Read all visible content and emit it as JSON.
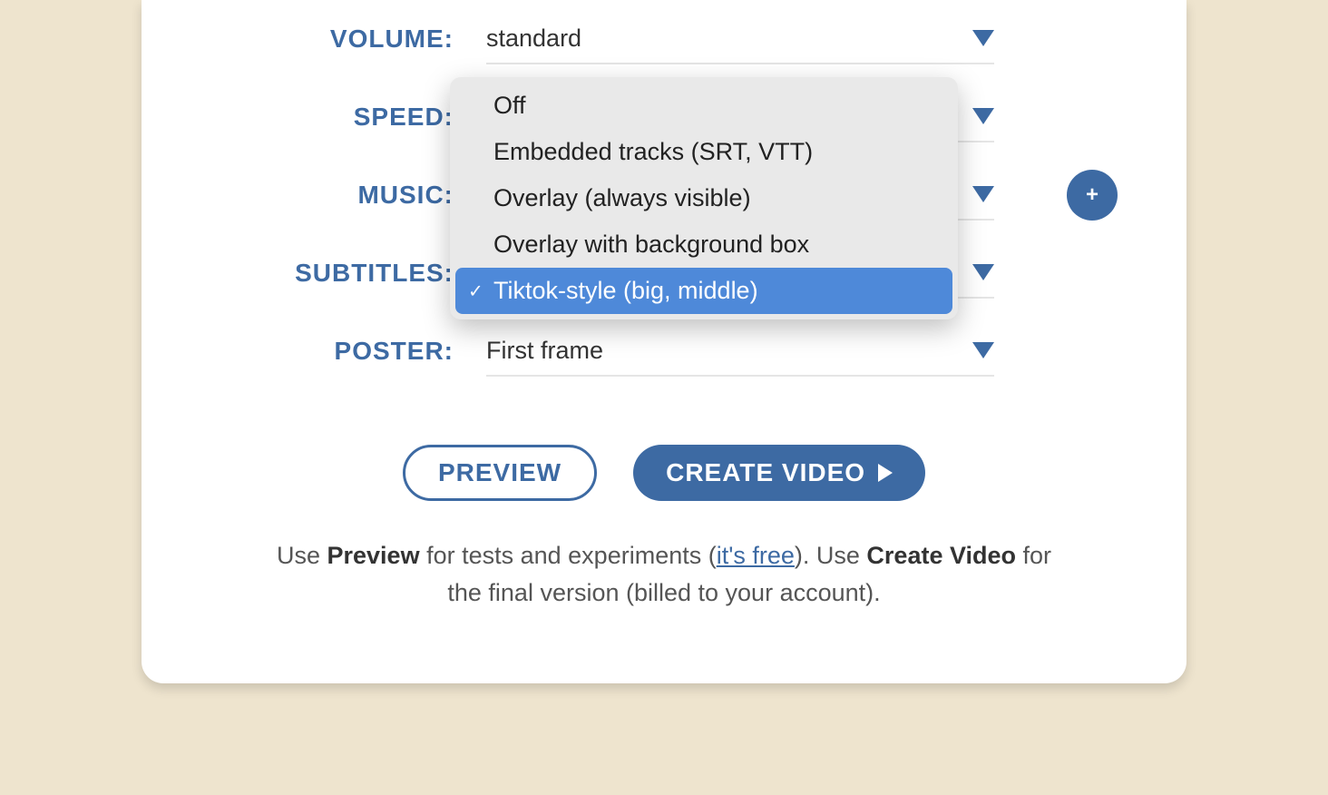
{
  "volume": {
    "label": "VOLUME:",
    "value": "standard"
  },
  "speed": {
    "label": "SPEED:"
  },
  "music": {
    "label": "MUSIC:"
  },
  "subtitles": {
    "label": "SUBTITLES:",
    "options": [
      "Off",
      "Embedded tracks (SRT, VTT)",
      "Overlay (always visible)",
      "Overlay with background box",
      "Tiktok-style (big, middle)"
    ],
    "selectedIndex": 4
  },
  "poster": {
    "label": "POSTER:",
    "value": "First frame"
  },
  "buttons": {
    "preview": "PREVIEW",
    "create": "CREATE VIDEO"
  },
  "hint": {
    "use1": "Use ",
    "previewWord": "Preview",
    "middle1": " for tests and experiments (",
    "freeLink": "it's free",
    "middle2": "). Use ",
    "createWord": "Create Video",
    "tail": " for the final version (billed to your account)."
  },
  "icons": {
    "plus": "+",
    "check": "✓"
  }
}
